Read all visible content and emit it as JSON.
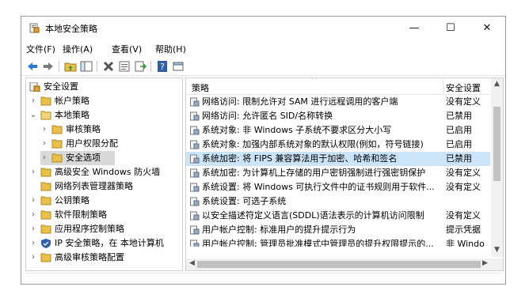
{
  "window": {
    "title": "本地安全策略",
    "minimize": "—",
    "maximize": "☐",
    "close": "✕"
  },
  "menu": {
    "file": "文件(F)",
    "action": "操作(A)",
    "view": "查看(V)",
    "help": "帮助(H)"
  },
  "tree": [
    {
      "label": "安全设置",
      "chev": ""
    },
    {
      "label": "帐户策略",
      "chev": "›"
    },
    {
      "label": "本地策略",
      "chev": "⌄"
    },
    {
      "label": "审核策略",
      "chev": "›"
    },
    {
      "label": "用户权限分配",
      "chev": "›"
    },
    {
      "label": "安全选项",
      "chev": "›"
    },
    {
      "label": "高级安全 Windows 防火墙",
      "chev": "›"
    },
    {
      "label": "网络列表管理器策略",
      "chev": ""
    },
    {
      "label": "公钥策略",
      "chev": "›"
    },
    {
      "label": "软件限制策略",
      "chev": "›"
    },
    {
      "label": "应用程序控制策略",
      "chev": "›"
    },
    {
      "label": "IP 安全策略，在 本地计算机",
      "chev": "›"
    },
    {
      "label": "高级审核策略配置",
      "chev": "›"
    }
  ],
  "list": {
    "header_policy": "策略",
    "header_setting": "安全设置",
    "sort_caret": "^",
    "rows": [
      {
        "policy": "网络访问: 限制允许对 SAM 进行远程调用的客户端",
        "setting": "没有定义"
      },
      {
        "policy": "网络访问: 允许匿名 SID/名称转换",
        "setting": "已禁用"
      },
      {
        "policy": "系统对象: 非 Windows 子系统不要求区分大小写",
        "setting": "已启用"
      },
      {
        "policy": "系统对象: 加强内部系统对象的默认权限(例如，符号链接)",
        "setting": "已启用"
      },
      {
        "policy": "系统加密: 将 FIPS 兼容算法用于加密、哈希和签名",
        "setting": "已禁用"
      },
      {
        "policy": "系统加密: 为计算机上存储的用户密钥强制进行强密钥保护",
        "setting": "没有定义"
      },
      {
        "policy": "系统设置: 将 Windows 可执行文件中的证书规则用于软件...",
        "setting": "没有定义"
      },
      {
        "policy": "系统设置: 可选子系统",
        "setting": ""
      },
      {
        "policy": "以安全描述符定义语言(SDDL)语法表示的计算机访问限制",
        "setting": "没有定义"
      },
      {
        "policy": "用户帐户控制: 标准用户的提升提示行为",
        "setting": "提示凭据"
      },
      {
        "policy": "用户帐户控制: 管理员批准模式中管理员的提升权限提示的...",
        "setting": "非 Windo"
      }
    ]
  },
  "scroll": {
    "up": "▲",
    "down": "▼",
    "left": "◀",
    "right": "▶"
  },
  "colors": {
    "selection": "#cce4f7",
    "tree_selection": "#d9d9d9",
    "folder": "#e8c04a"
  }
}
